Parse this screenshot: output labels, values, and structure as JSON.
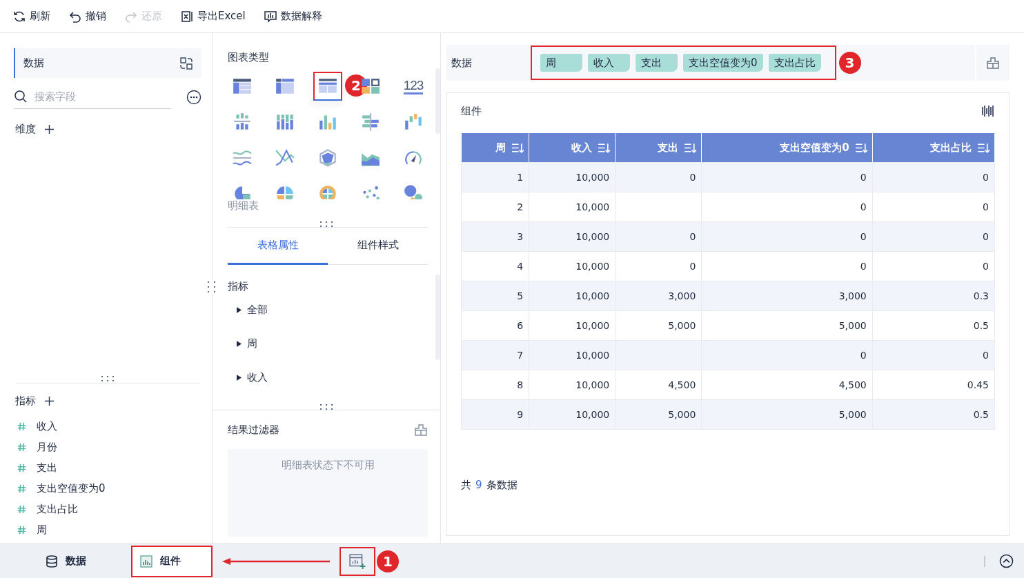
{
  "toolbar": [
    {
      "label": "刷新",
      "disabled": false
    },
    {
      "label": "撤销",
      "disabled": false
    },
    {
      "label": "还原",
      "disabled": true
    },
    {
      "label": "导出Excel",
      "disabled": false
    },
    {
      "label": "数据解释",
      "disabled": false
    }
  ],
  "data_panel": {
    "title": "数据",
    "search": {
      "placeholder": "搜索字段"
    },
    "dimensions_label": "维度",
    "measures_label": "指标",
    "measures": [
      "收入",
      "月份",
      "支出",
      "支出空值变为0",
      "支出占比",
      "周"
    ]
  },
  "chart_panel": {
    "title": "图表类型",
    "chart_types": [
      {
        "selected": false
      },
      {
        "selected": false
      },
      {
        "selected": true
      },
      {
        "selected": false
      },
      {
        "glyph": "123",
        "selected": false
      },
      {
        "selected": false
      },
      {
        "selected": false
      },
      {
        "selected": false
      },
      {
        "selected": false
      },
      {
        "selected": false
      },
      {
        "selected": false
      },
      {
        "selected": false
      },
      {
        "selected": false
      },
      {
        "selected": false
      },
      {
        "selected": false
      },
      {
        "selected": false
      },
      {
        "selected": false
      },
      {
        "selected": false
      },
      {
        "selected": false
      },
      {
        "selected": false
      }
    ],
    "selected_name": "明细表",
    "tabs": [
      {
        "label": "表格属性",
        "selected": true
      },
      {
        "label": "组件样式",
        "selected": false
      }
    ],
    "section": "指标",
    "items": [
      "全部",
      "周",
      "收入"
    ],
    "filter": {
      "title": "结果过滤器",
      "message": "明细表状态下不可用"
    }
  },
  "fields_bar": {
    "label": "数据",
    "fields": [
      "周",
      "收入",
      "支出",
      "支出空值变为0",
      "支出占比"
    ]
  },
  "component": {
    "title": "组件",
    "table": {
      "columns": [
        "周",
        "收入",
        "支出",
        "支出空值变为0",
        "支出占比"
      ],
      "rows": [
        [
          "1",
          "10,000",
          "0",
          "0",
          "0"
        ],
        [
          "2",
          "10,000",
          null,
          "0",
          "0"
        ],
        [
          "3",
          "10,000",
          "0",
          "0",
          "0"
        ],
        [
          "4",
          "10,000",
          "0",
          "0",
          "0"
        ],
        [
          "5",
          "10,000",
          "3,000",
          "3,000",
          "0.3"
        ],
        [
          "6",
          "10,000",
          "5,000",
          "5,000",
          "0.5"
        ],
        [
          "7",
          "10,000",
          null,
          "0",
          "0"
        ],
        [
          "8",
          "10,000",
          "4,500",
          "4,500",
          "0.45"
        ],
        [
          "9",
          "10,000",
          "5,000",
          "5,000",
          "0.5"
        ]
      ]
    },
    "footer": {
      "prefix": "共",
      "count": "9",
      "suffix": "条数据"
    }
  },
  "bottom_tabs": [
    {
      "label": "数据",
      "selected": false
    },
    {
      "label": "组件",
      "selected": true
    }
  ],
  "callouts": [
    "1",
    "2",
    "3"
  ]
}
